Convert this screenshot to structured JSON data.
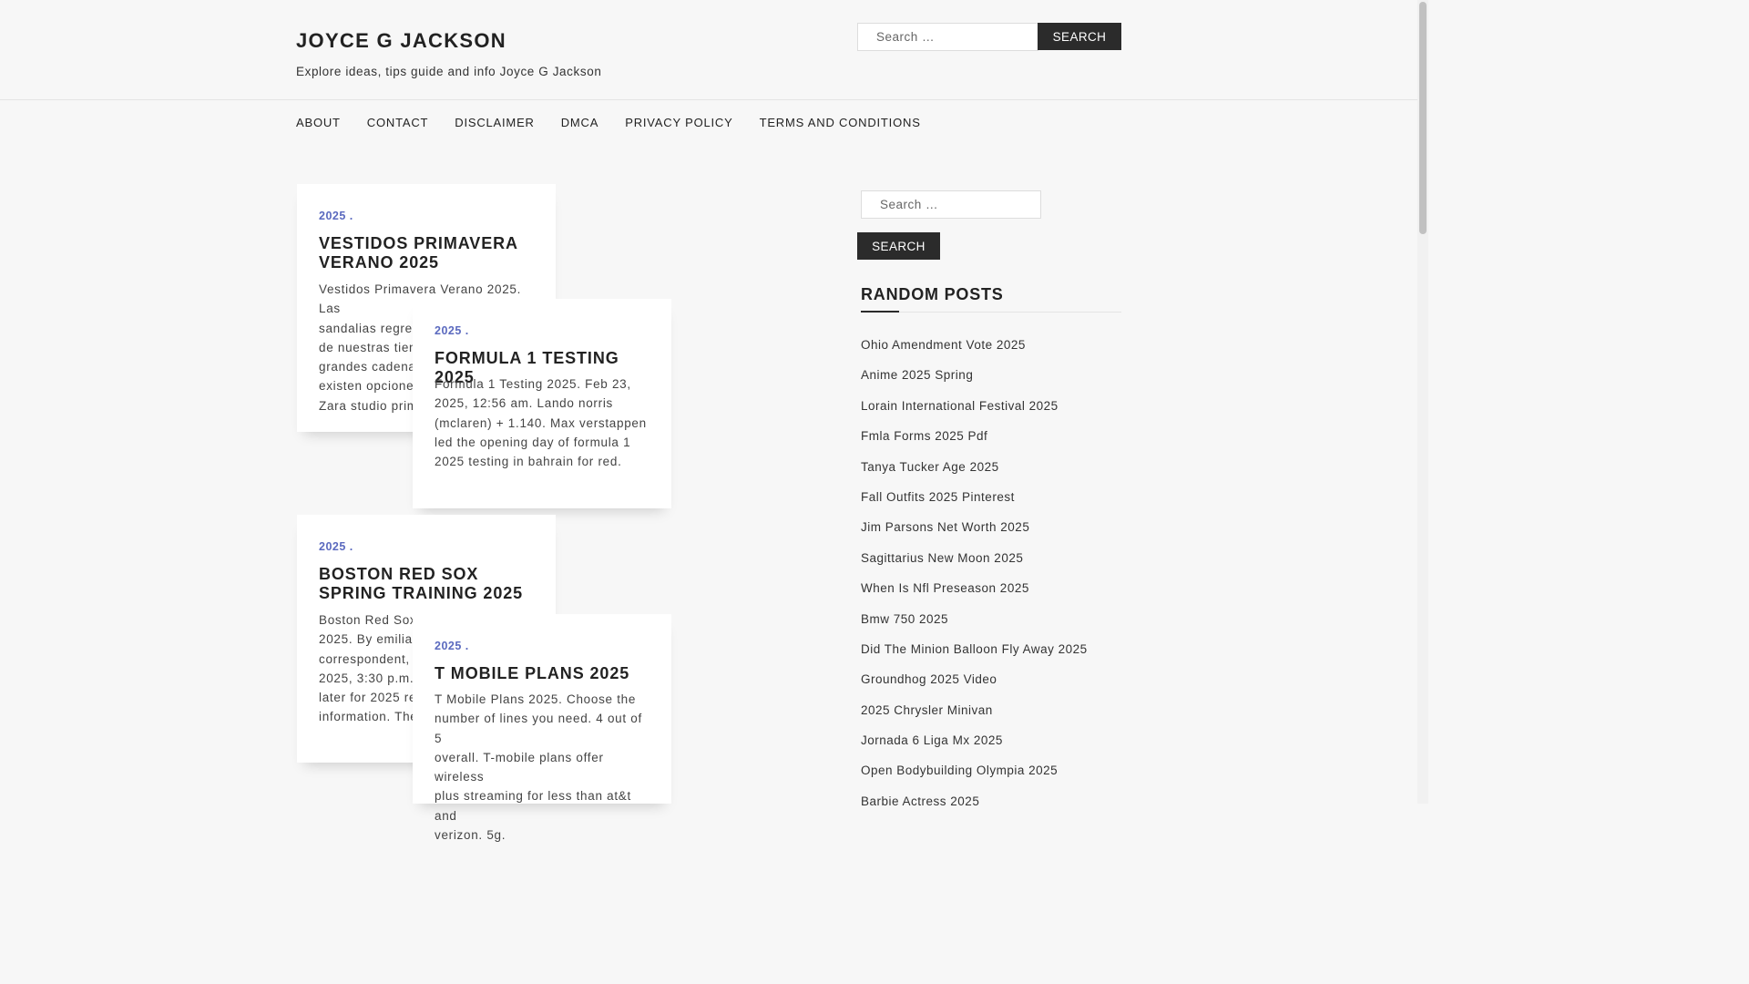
{
  "site": {
    "title": "JOYCE G JACKSON",
    "description": "Explore ideas, tips guide and info Joyce G Jackson"
  },
  "header_search": {
    "placeholder": "Search …",
    "button": "SEARCH"
  },
  "nav": {
    "items": [
      "ABOUT",
      "CONTACT",
      "DISCLAIMER",
      "DMCA",
      "PRIVACY POLICY",
      "TERMS AND CONDITIONS"
    ]
  },
  "posts": [
    {
      "category": "2025",
      "title": "VESTIDOS PRIMAVERA VERANO 2025",
      "excerpt_lines": [
        "Vestidos Primavera Verano 2025. Las",
        "sandalias regresan",
        "de nuestras tiendas",
        "grandes cadenas",
        "existen opciones",
        "Zara studio prim"
      ]
    },
    {
      "category": "2025",
      "title": "FORMULA 1 TESTING 2025",
      "excerpt_lines": [
        "Formula 1 Testing 2025. Feb 23,",
        "2025, 12:56 am. Lando norris",
        "(mclaren) + 1.140. Max verstappen",
        "led the opening day of formula 1",
        "2025 testing in bahrain for red."
      ]
    },
    {
      "category": "2025",
      "title": "BOSTON RED SOX SPRING TRAINING 2025",
      "excerpt_lines": [
        "Boston Red Sox",
        "2025. By emilia v",
        "correspondent, u",
        "2025, 3:30 p.m.",
        "later for 2025 re",
        "information. The"
      ]
    },
    {
      "category": "2025",
      "title": "T MOBILE PLANS 2025",
      "excerpt_lines": [
        "T Mobile Plans 2025. Choose the",
        "number of lines you need. 4 out of 5",
        "overall. T-mobile plans offer wireless",
        "plus streaming for less than at&t and",
        "verizon. 5g."
      ]
    }
  ],
  "sidebar": {
    "search_placeholder": "Search …",
    "search_button": "SEARCH",
    "widget_title": "RANDOM POSTS",
    "random_posts": [
      "Ohio Amendment Vote 2025",
      "Anime 2025 Spring",
      "Lorain International Festival 2025",
      "Fmla Forms 2025 Pdf",
      "Tanya Tucker Age 2025",
      "Fall Outfits 2025 Pinterest",
      "Jim Parsons Net Worth 2025",
      "Sagittarius New Moon 2025",
      "When Is Nfl Preseason 2025",
      "Bmw 750 2025",
      "Did The Minion Balloon Fly Away 2025",
      "Groundhog 2025 Video",
      "2025 Chrysler Minivan",
      "Jornada 6 Liga Mx 2025",
      "Open Bodybuilding Olympia 2025",
      "Barbie Actress 2025"
    ]
  },
  "colors": {
    "accent": "#5b6abf",
    "button": "#2b2b2b",
    "background": "#f7f7f7"
  }
}
